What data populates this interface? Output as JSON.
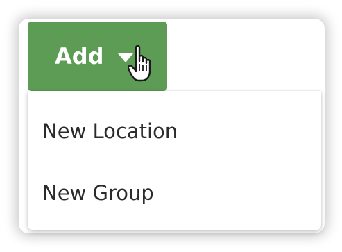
{
  "add_button": {
    "label": "Add",
    "caret_icon": "caret-down-icon",
    "color": "#5d9c55"
  },
  "cursor": {
    "icon": "hand-pointer-icon"
  },
  "menu": {
    "items": [
      {
        "label": "New Location"
      },
      {
        "label": "New Group"
      }
    ]
  }
}
